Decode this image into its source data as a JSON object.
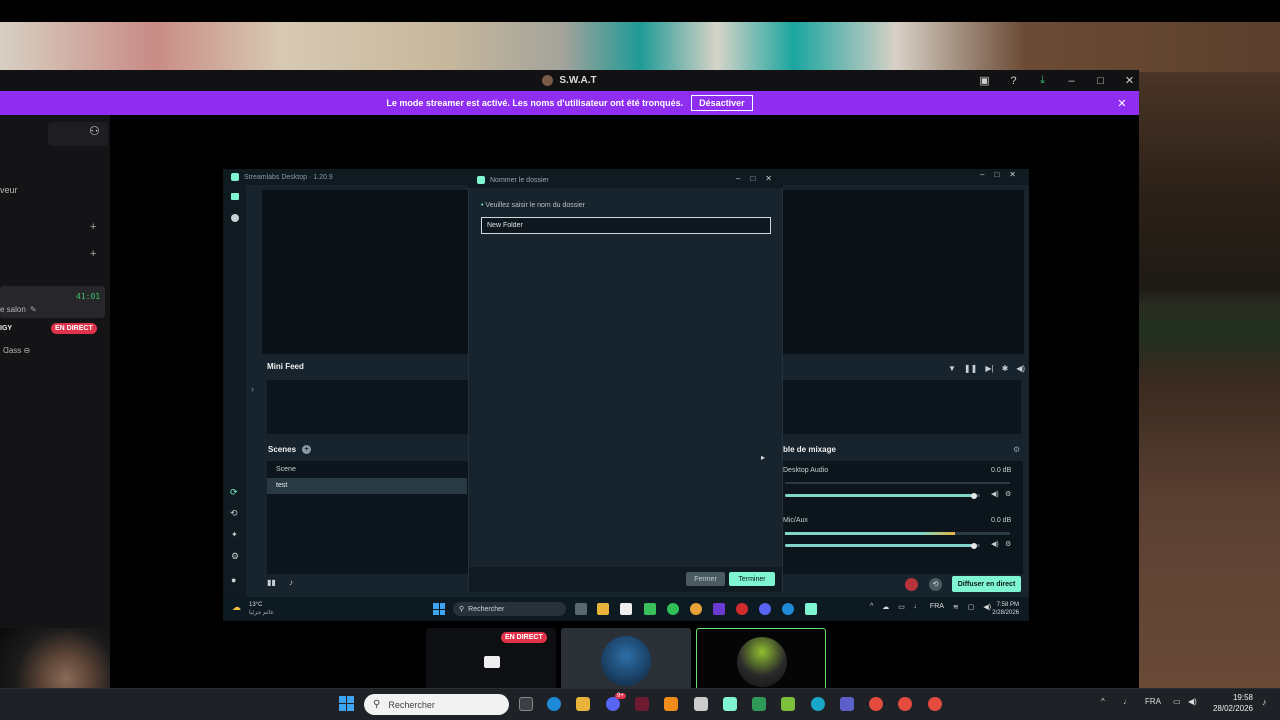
{
  "discord": {
    "window_title": "S.W.A.T",
    "streamer_banner": "Le mode streamer est activé. Les noms d'utilisateur ont été tronqués.",
    "streamer_button": "Désactiver",
    "sidebar": {
      "server_label": "veur",
      "channel_timer": "41:01",
      "channel_name": "e salon",
      "live_user": "IGY",
      "live_badge": "EN DIRECT",
      "user_status": "Ɑass ⊖"
    },
    "stream_badge": "EN DIRECT"
  },
  "streamlabs": {
    "window_title": "Streamlabs Desktop · 1.20.9",
    "mini_feed": "Mini Feed",
    "scenes_title": "Scenes",
    "scenes": [
      "Scene",
      "test"
    ],
    "mixer_title": "ble de mixage",
    "mixer": [
      {
        "name": "Desktop Audio",
        "level": "0.0 dB",
        "value": 0.97
      },
      {
        "name": "Mic/Aux",
        "level": "0.0 dB",
        "value": 0.97
      }
    ],
    "go_live": "Diffuser en direct"
  },
  "dialog": {
    "title": "Nommer le dossier",
    "label": "Veuillez saisir le nom du dossier",
    "input_value": "New Folder",
    "close_button": "Fermer",
    "done_button": "Terminer"
  },
  "inner_taskbar": {
    "weather_temp": "13°C",
    "weather_sub": "غائم جزئيا",
    "search": "Rechercher",
    "lang": "FRA",
    "time": "7:58 PM",
    "date": "2/28/2026"
  },
  "taskbar": {
    "search": "Rechercher",
    "lang": "FRA",
    "time": "19:58",
    "date": "28/02/2026",
    "discord_badge": "9+"
  }
}
